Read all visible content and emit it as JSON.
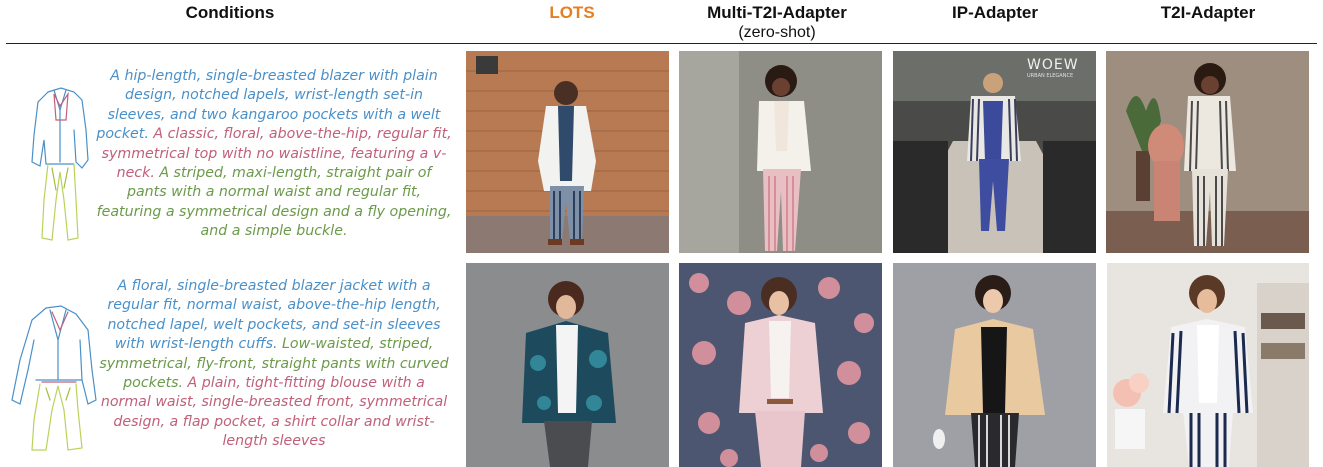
{
  "headers": {
    "conditions": "Conditions",
    "lots": "LOTS",
    "multi_t2i": "Multi-T2I-Adapter",
    "multi_t2i_sub": "(zero-shot)",
    "ip_adapter": "IP-Adapter",
    "t2i_adapter": "T2I-Adapter"
  },
  "rows": [
    {
      "segments": [
        {
          "text": "A hip-length, single-breasted blazer with plain design, notched lapels, wrist-length set-in sleeves, and two kangaroo pockets with a welt pocket. ",
          "color": "blue"
        },
        {
          "text": "A classic, floral, above-the-hip, regular fit, symmetrical top with no waistline, featuring a v-neck. ",
          "color": "pink"
        },
        {
          "text": "A striped, maxi-length, straight pair of pants with a normal waist and regular fit, featuring a symmetrical design and a fly opening, and a simple buckle.",
          "color": "green"
        }
      ]
    },
    {
      "segments": [
        {
          "text": "A floral, single-breasted blazer jacket with a regular fit, normal waist, above-the-hip length, notched lapel, welt pockets, and set-in sleeves with wrist-length cuffs. ",
          "color": "blue"
        },
        {
          "text": "Low-waisted, striped, symmetrical, fly-front, straight pants with curved pockets. ",
          "color": "green"
        },
        {
          "text": "A plain, tight-fitting blouse with a normal waist, single-breasted front, symmetrical design, a flap pocket, a shirt collar and wrist-length sleeves",
          "color": "pink"
        }
      ]
    }
  ],
  "ip_adapter_watermark": "WOEW",
  "ip_adapter_watermark_sub": "URBAN ELEGANCE",
  "colors": {
    "lots_header": "#e67e22",
    "blue": "#4a90c8",
    "pink": "#c0607a",
    "green": "#6b9a4a"
  }
}
